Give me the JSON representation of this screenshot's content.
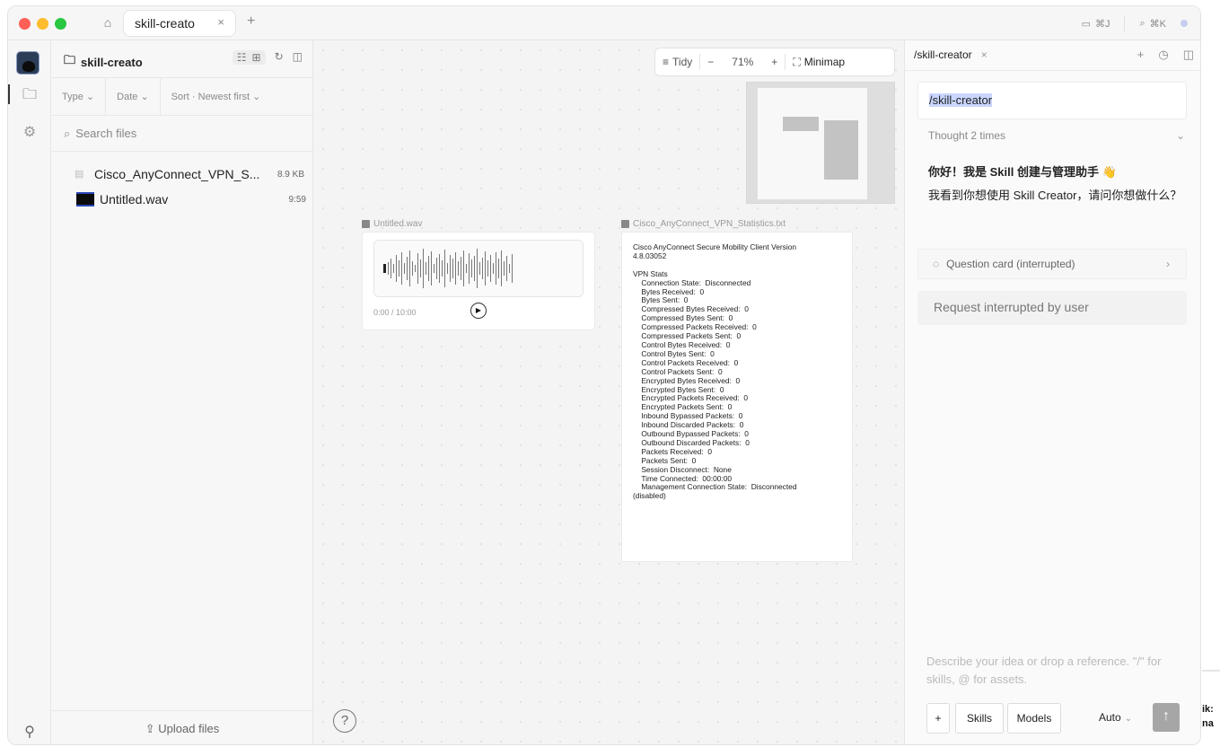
{
  "titlebar": {
    "tab_label": "skill-creato",
    "tab_close": "×",
    "new_tab": "+",
    "shortcut_1": "⌘J",
    "shortcut_2": "⌘K"
  },
  "files": {
    "title": "skill-creato",
    "filters": [
      "Type",
      "Date",
      "Sort · Newest first"
    ],
    "search_placeholder": "Search files",
    "items": [
      {
        "name": "Cisco_AnyConnect_VPN_S...",
        "meta": "8.9 KB"
      },
      {
        "name": "Untitled.wav",
        "meta": "9:59"
      }
    ],
    "upload_label": "Upload files"
  },
  "canvas": {
    "toolbar": {
      "tidy": "Tidy",
      "minus": "−",
      "zoom": "71%",
      "plus": "+",
      "minimap": "Minimap"
    },
    "audio_card": {
      "label": "Untitled.wav",
      "time": "0:00 / 10:00"
    },
    "text_card": {
      "label": "Cisco_AnyConnect_VPN_Statistics.txt",
      "content": "Cisco AnyConnect Secure Mobility Client Version\n4.8.03052\n\nVPN Stats\n    Connection State:  Disconnected\n    Bytes Received:  0\n    Bytes Sent:  0\n    Compressed Bytes Received:  0\n    Compressed Bytes Sent:  0\n    Compressed Packets Received:  0\n    Compressed Packets Sent:  0\n    Control Bytes Received:  0\n    Control Bytes Sent:  0\n    Control Packets Received:  0\n    Control Packets Sent:  0\n    Encrypted Bytes Received:  0\n    Encrypted Bytes Sent:  0\n    Encrypted Packets Received:  0\n    Encrypted Packets Sent:  0\n    Inbound Bypassed Packets:  0\n    Inbound Discarded Packets:  0\n    Outbound Bypassed Packets:  0\n    Outbound Discarded Packets:  0\n    Packets Received:  0\n    Packets Sent:  0\n    Session Disconnect:  None\n    Time Connected:  00:00:00\n    Management Connection State:  Disconnected\n(disabled)"
    },
    "help": "?"
  },
  "chat": {
    "tab_label": "/skill-creator",
    "tab_close": "×",
    "prompt": "/skill-creator",
    "thought": "Thought 2 times",
    "message_line1": "你好！我是 Skill 创建与管理助手 👋",
    "message_line2": "我看到你想使用 Skill Creator，请问你想做什么？",
    "question_card": "Question card  (interrupted)",
    "interrupted": "Request interrupted by user",
    "composer_placeholder": "Describe your idea or drop a reference. \"/\" for skills, @ for assets.",
    "btn_plus": "+",
    "btn_skills": "Skills",
    "btn_models": "Models",
    "auto": "Auto",
    "send": "↑"
  },
  "edge_text": "ik:\nna",
  "icons": [
    "home-icon",
    "folder-icon",
    "puzzle-icon",
    "user-add-icon",
    "refresh-icon",
    "search-icon",
    "upload-icon",
    "minimap-icon",
    "history-icon",
    "split-icon",
    "play-icon",
    "chat-bubble-icon"
  ]
}
